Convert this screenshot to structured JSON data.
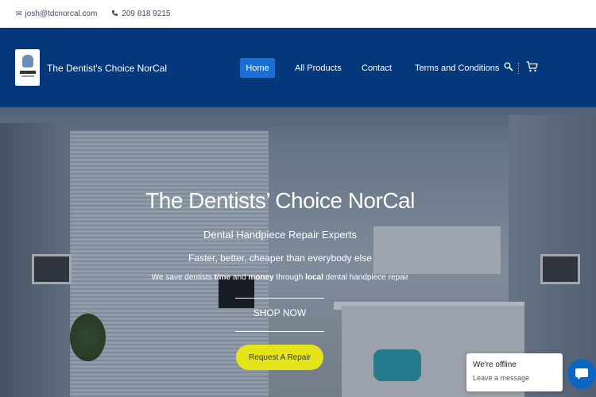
{
  "topbar": {
    "email": "josh@tdcnorcal.com",
    "phone": "209 818 9215",
    "email_icon": "mail-icon",
    "phone_icon": "phone-icon"
  },
  "header": {
    "brand": "The Dentist's Choice NorCal",
    "nav": {
      "home": "Home",
      "all_products": "All Products",
      "contact": "Contact",
      "terms": "Terms and Conditions"
    },
    "icons": [
      "search-icon",
      "cart-icon"
    ],
    "colors": {
      "background": "#04387a",
      "active": "#1a6fd6"
    }
  },
  "hero": {
    "title": "The Dentists’ Choice NorCal",
    "subtitle": "Dental Handpiece Repair Experts",
    "tagline": "Faster, better, cheaper than everybody else",
    "desc_1": "We save dentists ",
    "desc_time": "time",
    "desc_2": " and ",
    "desc_money": "money",
    "desc_3": " through ",
    "desc_local": "local",
    "desc_4": " dental handpiece repair",
    "shop_now": "SHOP NOW",
    "request_repair": "Request A Repair",
    "colors": {
      "cta": "#e5e41a"
    }
  },
  "chat": {
    "status": "We're offline",
    "message": "Leave a message",
    "icon": "chat-icon"
  }
}
